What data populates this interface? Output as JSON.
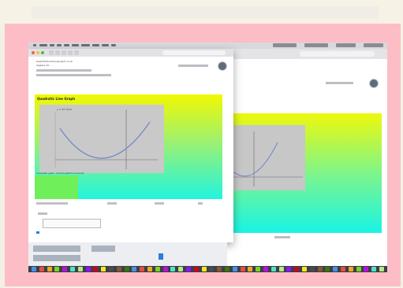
{
  "header": {
    "site_title": "www.thefunctionsproject.co.uk",
    "subtitle": "Algebra 1b"
  },
  "panel": {
    "title": "Quadratic Line Graph",
    "link_text": "A quadratic graph - click the graph for more info"
  },
  "graph": {
    "label": "y = 2x²-4x-6"
  },
  "colors": {
    "pink_frame": "#fdbdc6",
    "gradient_top": "#f2f802",
    "gradient_bottom": "#22f4df",
    "graph_bg": "#c9c9c9",
    "curve": "#6e86c8",
    "dock": "#3a3f48"
  },
  "icons": [
    "close-icon",
    "minimize-icon",
    "zoom-icon",
    "back-icon",
    "forward-icon",
    "reload-icon",
    "avatar-icon",
    "dock-app-icon"
  ]
}
